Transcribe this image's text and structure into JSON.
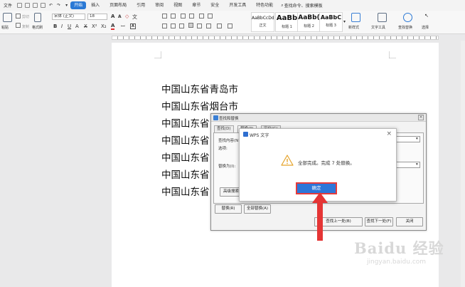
{
  "menubar": {
    "file_label": "文件",
    "tabs": [
      "开始",
      "插入",
      "页面布局",
      "引用",
      "审阅",
      "视图",
      "章节",
      "安全",
      "开发工具",
      "特色功能"
    ],
    "active_tab": "开始",
    "search_label": "查找命令、搜索模板",
    "accent_color": "#2b79d5"
  },
  "ribbon": {
    "paste_label": "粘贴",
    "cut_label": "剪切",
    "copy_label": "复制",
    "format_painter_label": "格式刷",
    "font_name": "宋体 (正文)",
    "font_size": "18",
    "styles": [
      {
        "preview": "AaBbCcDd",
        "name": "正文"
      },
      {
        "preview": "AaBb",
        "name": "标题 1"
      },
      {
        "preview": "AaBb(",
        "name": "标题 2"
      },
      {
        "preview": "AaBbC",
        "name": "标题 3"
      }
    ],
    "new_style_label": "新样式",
    "text_tools_label": "文字工具",
    "find_replace_label": "查找替换",
    "select_label": "选择"
  },
  "document": {
    "lines": [
      "中国山东省青岛市",
      "中国山东省烟台市",
      "中国山东省",
      "中国山东省",
      "中国山东省",
      "中国山东省",
      "中国山东省"
    ]
  },
  "find_replace": {
    "title": "查找和替换",
    "tabs": [
      "查找(D)",
      "替换(P)",
      "定位(G)"
    ],
    "find_label": "查找内容(N",
    "options_label": "选项:",
    "replace_label": "替换为(I):",
    "advanced_button": "高级搜索",
    "replace_button": "替换(R)",
    "replace_all_button": "全部替换(A)",
    "find_prev_button": "查找上一处(B)",
    "find_next_button": "查找下一处(F)",
    "close_button": "关闭"
  },
  "message_box": {
    "title": "WPS 文字",
    "message": "全部完成。完成 7 处替换。",
    "ok_button": "确定",
    "icon": "warning-icon"
  },
  "watermark": {
    "brand": "Baidu 经验",
    "url": "jingyan.baidu.com"
  }
}
